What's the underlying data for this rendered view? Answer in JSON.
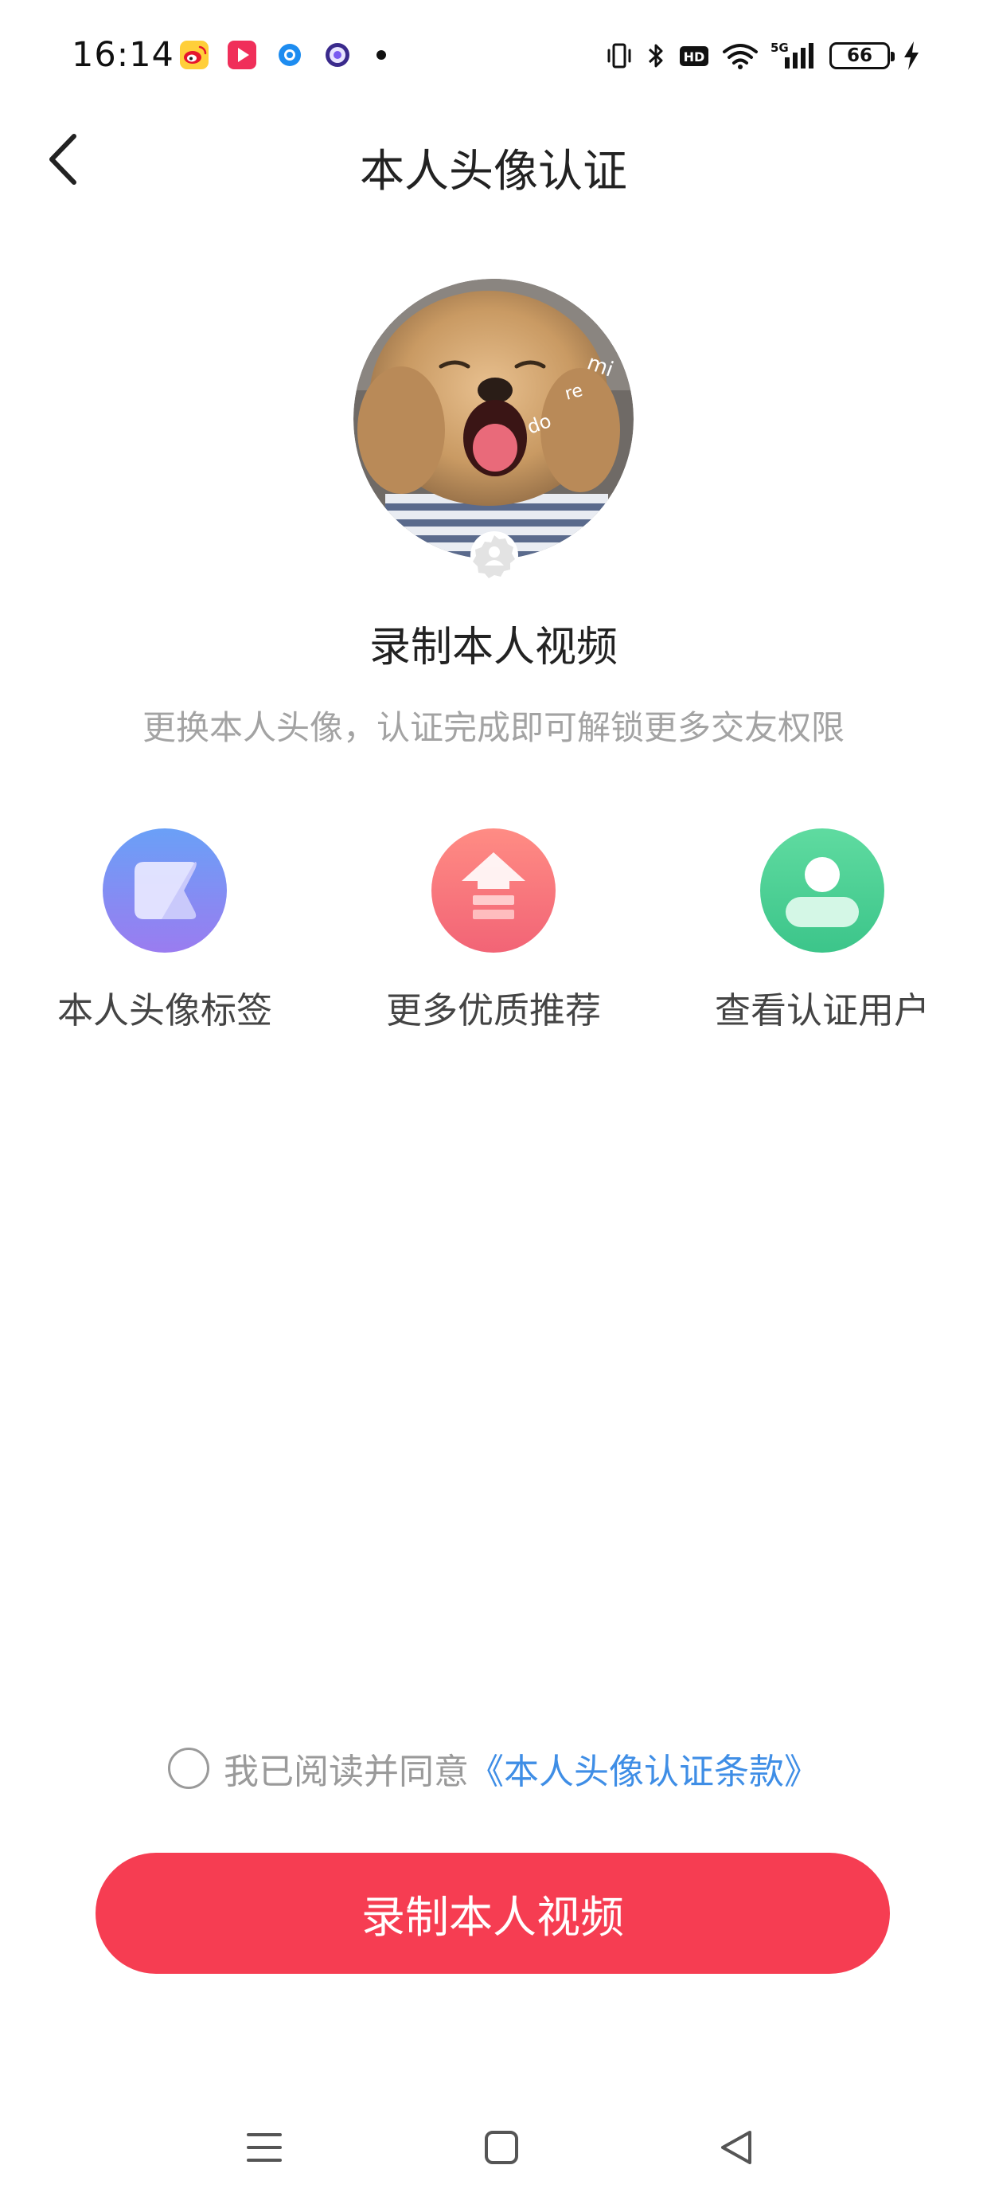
{
  "status_bar": {
    "time": "16:14",
    "battery_level": "66",
    "network": "5G",
    "notification_icons": [
      "weibo-icon",
      "video-app-icon",
      "blue-dot-app-icon",
      "purple-app-icon",
      "more-dot-icon"
    ],
    "system_icons": [
      "vibrate-icon",
      "bluetooth-icon",
      "hd-icon",
      "wifi-icon",
      "signal-5g-icon",
      "battery-icon",
      "charging-icon"
    ]
  },
  "header": {
    "title": "本人头像认证",
    "back_icon": "chevron-left-icon"
  },
  "hero": {
    "avatar_desc": "user-avatar",
    "heading": "录制本人视频",
    "subtitle": "更换本人头像，认证完成即可解锁更多交友权限"
  },
  "features": [
    {
      "label": "本人头像标签",
      "icon": "tag-icon",
      "color": "#7f8df4"
    },
    {
      "label": "更多优质推荐",
      "icon": "arrow-up-icon",
      "color": "#f77b7e"
    },
    {
      "label": "查看认证用户",
      "icon": "user-icon",
      "color": "#4fd29a"
    }
  ],
  "agreement": {
    "prefix": "我已阅读并同意",
    "link": "《本人头像认证条款》"
  },
  "primary_button": {
    "label": "录制本人视频",
    "color": "#f63d52"
  },
  "nav_bar": {
    "items": [
      "menu-icon",
      "home-icon",
      "back-icon"
    ]
  }
}
